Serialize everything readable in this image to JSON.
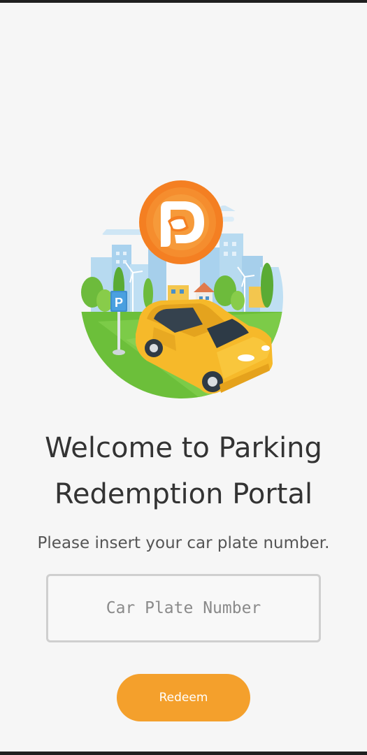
{
  "app": {
    "logo_icon": "parking-redemption-logo-icon",
    "illustration": "yellow-car-parking-city-illustration",
    "parking_sign_letter": "P"
  },
  "welcome": {
    "title_line1": "Welcome to Parking",
    "title_line2": "Redemption Portal",
    "subtitle": "Please insert your car plate number."
  },
  "form": {
    "plate_value": "",
    "plate_placeholder": "Car Plate Number",
    "redeem_label": "Redeem"
  },
  "colors": {
    "accent": "#f4a02c",
    "logo_orange": "#f47f22",
    "car_yellow": "#f6b92a",
    "grass_green": "#6cbf3a",
    "background": "#f6f6f6"
  }
}
